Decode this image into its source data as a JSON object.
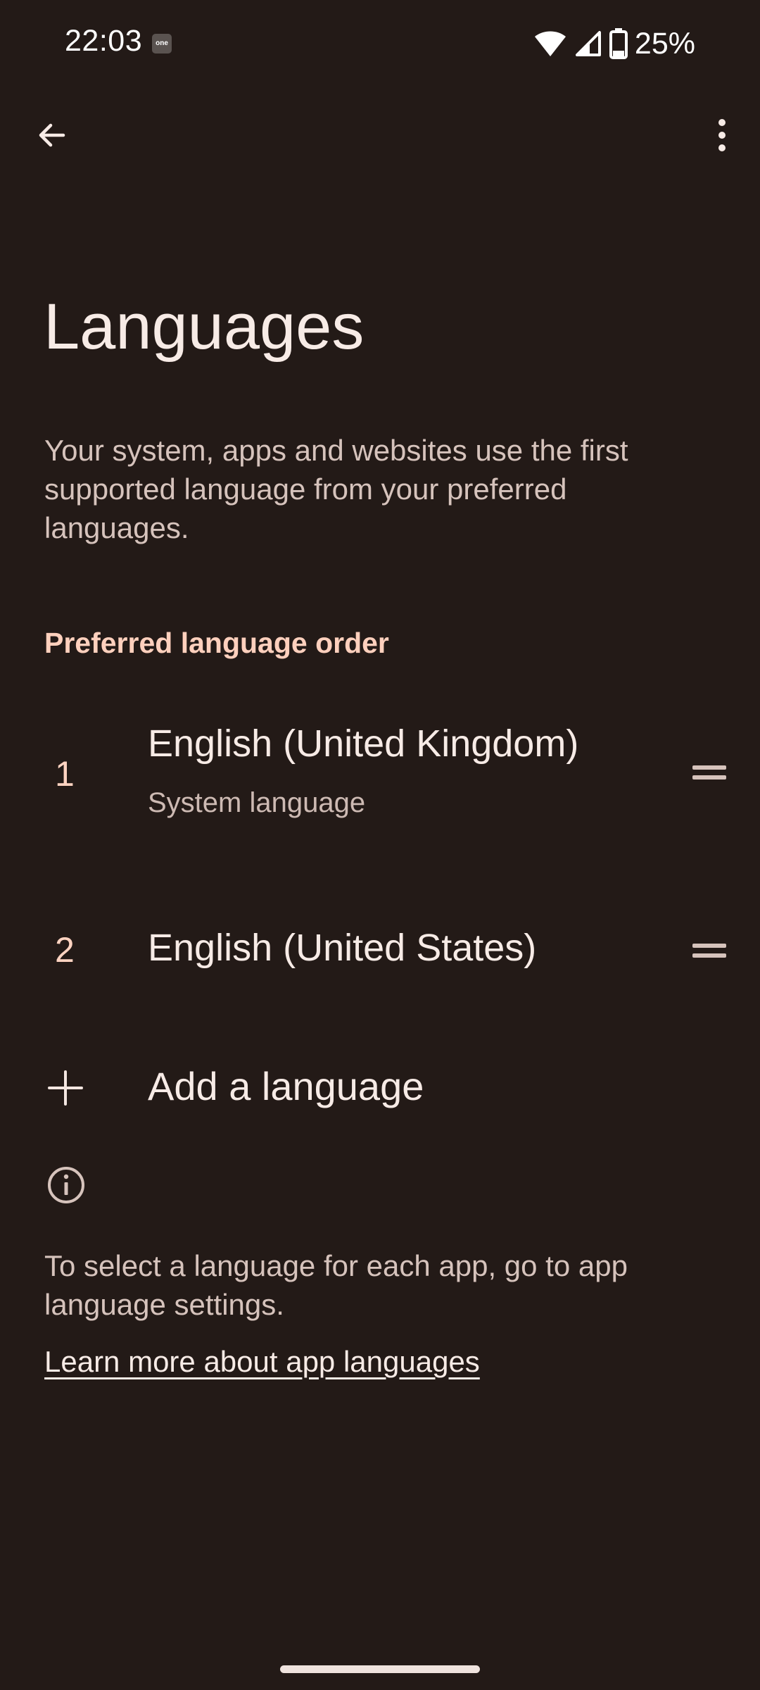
{
  "status_bar": {
    "time": "22:03",
    "notification_icon_label": "one",
    "battery_text": "25%"
  },
  "toolbar": {
    "back_icon": "arrow-back-icon",
    "more_icon": "more-vert-icon"
  },
  "page": {
    "title": "Languages",
    "description": "Your system, apps and websites use the first supported language from your preferred languages."
  },
  "preferred": {
    "header": "Preferred language order",
    "items": [
      {
        "number": "1",
        "name": "English (United Kingdom)",
        "subtitle": "System language"
      },
      {
        "number": "2",
        "name": "English (United States)"
      }
    ]
  },
  "add_language": {
    "label": "Add a language"
  },
  "info": {
    "text": "To select a language for each app, go to app language settings.",
    "link": "Learn more about app languages"
  },
  "colors": {
    "background": "#231a17",
    "accent": "#ffd0bd",
    "primary_text": "#f7ebe6",
    "secondary_text": "#d6c3bc"
  }
}
